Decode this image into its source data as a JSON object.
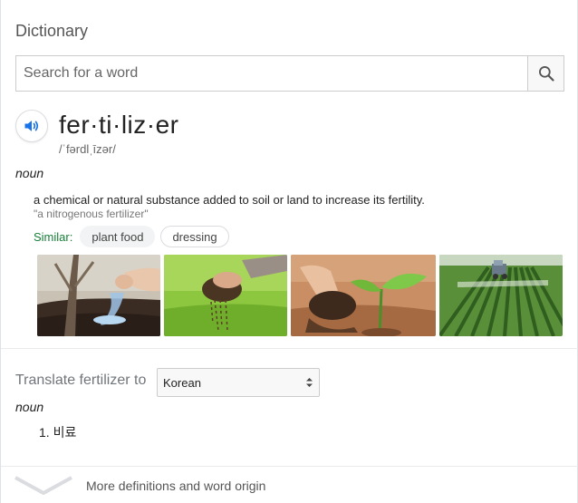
{
  "widget": {
    "title": "Dictionary"
  },
  "search": {
    "placeholder": "Search for a word",
    "value": ""
  },
  "entry": {
    "headword": "fer·ti·liz·er",
    "phonetic": "/ˈfərdlˌīzər/",
    "part_of_speech": "noun",
    "definition": "a chemical or natural substance added to soil or land to increase its fertility.",
    "example": "\"a nitrogenous fertilizer\"",
    "similar_label": "Similar:",
    "similar": [
      "plant food",
      "dressing"
    ]
  },
  "images": [
    {
      "icon": "hand-spreading-granules-image"
    },
    {
      "icon": "soil-falling-on-grass-image"
    },
    {
      "icon": "seedling-in-hand-image"
    },
    {
      "icon": "tractor-spraying-field-image"
    }
  ],
  "translate": {
    "label": "Translate fertilizer to",
    "language": "Korean",
    "part_of_speech": "noun",
    "results": [
      "1. 비료"
    ]
  },
  "footer": {
    "more_label": "More definitions and word origin"
  },
  "colors": {
    "similar_label": "#188038",
    "audio_icon": "#1a73e8",
    "chip_bg": "#f1f3f4"
  }
}
